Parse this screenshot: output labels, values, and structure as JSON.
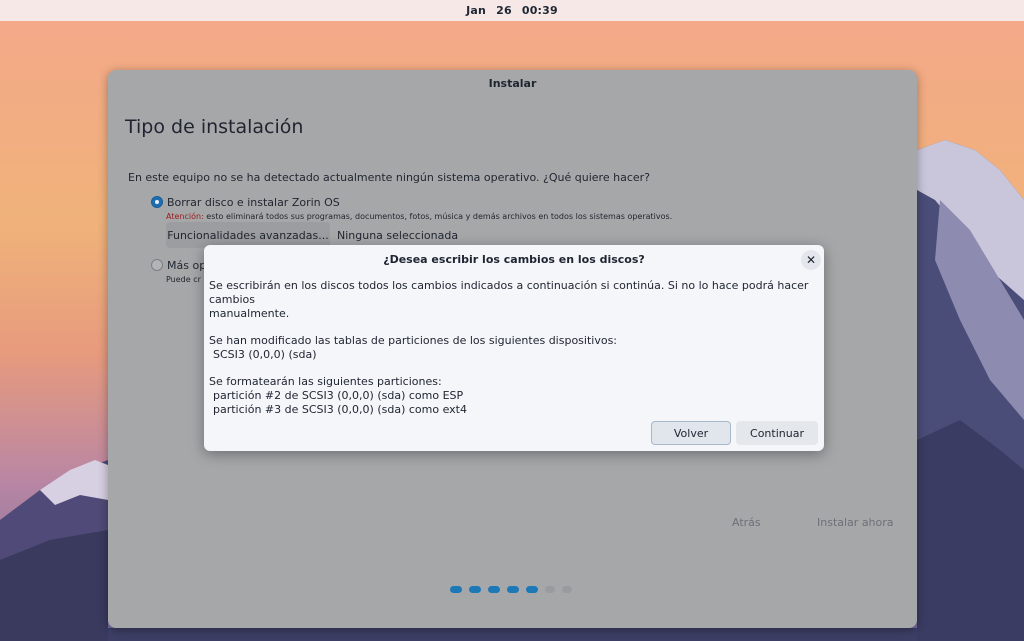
{
  "topbar": {
    "clock": "Jan 26  00:39"
  },
  "window": {
    "title": "Instalar",
    "page_title": "Tipo de instalación",
    "question": "En este equipo no se ha detectado actualmente ningún sistema operativo. ¿Qué quiere hacer?",
    "option1": {
      "label": "Borrar disco e instalar Zorin OS",
      "selected": true,
      "warning_prefix": "Atención:",
      "warning_text": " esto eliminará todos sus programas, documentos, fotos, música y demás archivos en todos los sistemas operativos.",
      "advanced_button": "Funcionalidades avanzadas...",
      "advanced_value": "Ninguna seleccionada"
    },
    "option2": {
      "label": "Más op",
      "description": "Puede cr",
      "selected": false
    },
    "back_button": "Atrás",
    "install_button": "Instalar ahora",
    "progress": {
      "total_steps": 7,
      "completed_steps": 5
    }
  },
  "dialog": {
    "title": "¿Desea escribir los cambios en los discos?",
    "close_icon": "close-icon",
    "line1": "Se escribirán en los discos todos los cambios indicados a continuación si continúa. Si no lo hace podrá hacer cambios",
    "line2": "manualmente.",
    "line3": "Se han modificado las tablas de particiones de los siguientes dispositivos:",
    "line4": "SCSI3 (0,0,0) (sda)",
    "line5": "Se formatearán las siguientes particiones:",
    "line6": "partición #2 de SCSI3 (0,0,0) (sda) como ESP",
    "line7": "partición #3 de SCSI3 (0,0,0) (sda) como ext4",
    "back_button": "Volver",
    "continue_button": "Continuar"
  },
  "colors": {
    "accent": "#1b6fb5",
    "warning": "#9b1a1a",
    "dialog_bg": "#f4f6fa",
    "window_dimmed": "#a6a7a9"
  }
}
